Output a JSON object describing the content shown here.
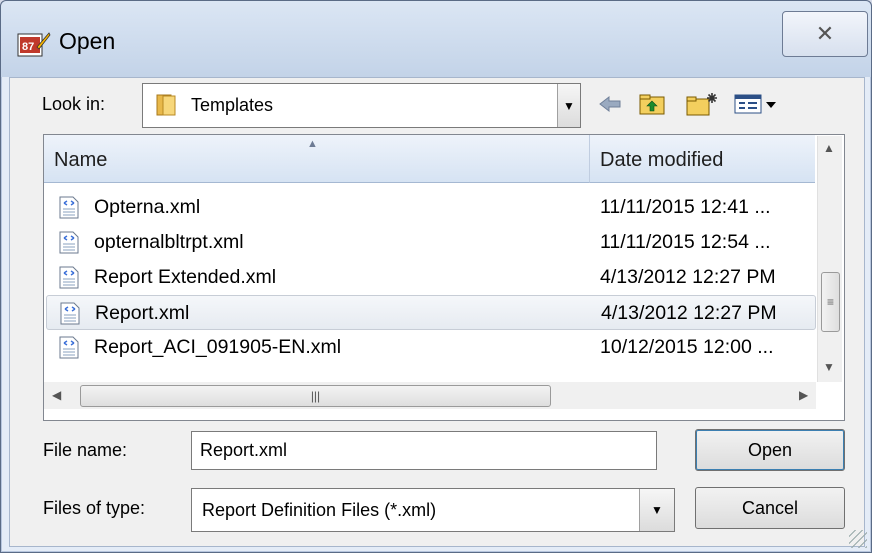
{
  "window": {
    "title": "Open",
    "close_symbol": "✕"
  },
  "lookin": {
    "label": "Look in:",
    "value": "Templates"
  },
  "toolbar": {
    "back_icon": "back-arrow-icon",
    "up_icon": "up-folder-icon",
    "new_folder_icon": "new-folder-icon",
    "views_icon": "views-menu-icon"
  },
  "columns": {
    "name": "Name",
    "date": "Date modified"
  },
  "files": [
    {
      "name": "Opterna.xml",
      "date": "11/11/2015 12:41 ..."
    },
    {
      "name": "opternalbltrpt.xml",
      "date": "11/11/2015 12:54 ..."
    },
    {
      "name": "Report Extended.xml",
      "date": "4/13/2012 12:27 PM"
    },
    {
      "name": "Report.xml",
      "date": "4/13/2012 12:27 PM"
    },
    {
      "name": "Report_ACI_091905-EN.xml",
      "date": "10/12/2015 12:00 ..."
    }
  ],
  "form": {
    "filename_label": "File name:",
    "filename_value": "Report.xml",
    "filetype_label": "Files of type:",
    "filetype_value": "Report Definition Files (*.xml)"
  },
  "buttons": {
    "open": "Open",
    "cancel": "Cancel"
  },
  "colors": {
    "selection": "#e6ebf1",
    "titlebar": "#c3d3e8",
    "button_focus": "#3c7fb1"
  }
}
